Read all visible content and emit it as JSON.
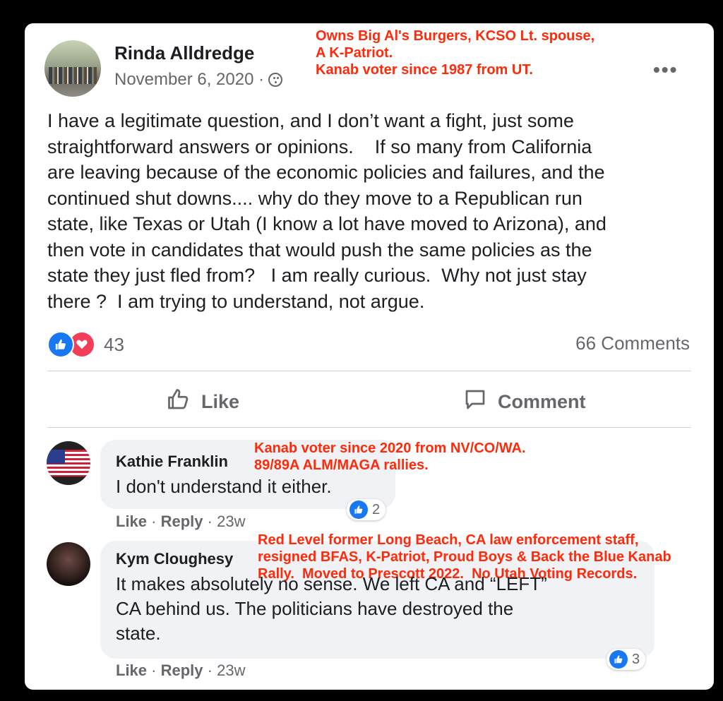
{
  "post": {
    "author": "Rinda Alldredge",
    "date": "November 6, 2020 ·",
    "privacy_icon": "friends-icon",
    "annotation": "Owns Big Al's Burgers, KCSO Lt. spouse,\nA K-Patriot.\nKanab voter since 1987 from UT.",
    "text": "I have a legitimate question, and I don’t want a fight, just some\nstraightforward answers or opinions.    If so many from California\nare leaving because of the economic policies and failures, and the\ncontinued shut downs.... why do they move to a Republican run\nstate, like Texas or Utah (I know a lot have moved to Arizona), and\nthen vote in candidates that would push the same policies as the\nstate they just fled from?   I am really curious.  Why not just stay\nthere ?  I am trying to understand, not argue.",
    "reaction_count": "43",
    "comments_count": "66 Comments",
    "more_label": "•••",
    "colors": {
      "like_blue": "#1877f2",
      "love_red": "#f33e58",
      "annotation_red": "#ff2a0a"
    }
  },
  "actions": {
    "like_label": "Like",
    "comment_label": "Comment"
  },
  "comments": [
    {
      "name": "Kathie Franklin",
      "text": "I don't understand it either.",
      "annotation": "Kanab voter since 2020 from NV/CO/WA.\n89/89A ALM/MAGA rallies.",
      "like_count": "2",
      "like_label": "Like",
      "reply_label": "Reply",
      "age": "· 23w",
      "sep": "·"
    },
    {
      "name": "Kym Cloughesy",
      "text": "It makes absolutely no sense. We left CA and “LEFT”\nCA behind us. The politicians have destroyed the\nstate.",
      "annotation": "Red Level former Long Beach, CA law enforcement staff,\nresigned BFAS, K-Patriot, Proud Boys & Back the Blue Kanab\nRally.  Moved to Prescott 2022.  No Utah Voting Records.",
      "like_count": "3",
      "like_label": "Like",
      "reply_label": "Reply",
      "age": "· 23w",
      "sep": "·"
    }
  ]
}
